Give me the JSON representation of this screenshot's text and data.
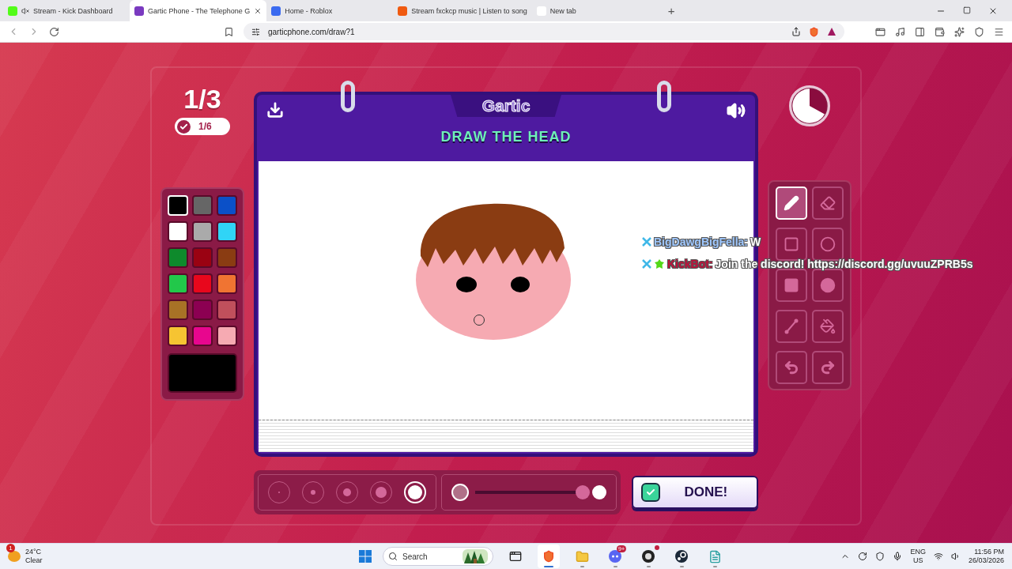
{
  "browser": {
    "tabs": [
      {
        "kind": "kick",
        "title": "Stream - Kick Dashboard",
        "muted": true,
        "selected": false
      },
      {
        "kind": "gartic",
        "title": "Gartic Phone - The Telephone G",
        "muted": false,
        "selected": true
      },
      {
        "kind": "roblox",
        "title": "Home - Roblox",
        "muted": false,
        "selected": false
      },
      {
        "kind": "soundcloud",
        "title": "Stream fxckcp music | Listen to song",
        "muted": false,
        "selected": false
      },
      {
        "kind": "brave",
        "title": "New tab",
        "muted": false,
        "selected": false
      }
    ],
    "new_tab": "+",
    "url": "garticphone.com/draw?1"
  },
  "game": {
    "round": "1/3",
    "done_count": "1/6",
    "logo": "Gartic",
    "prompt": "DRAW THE HEAD",
    "palette": [
      {
        "color": "#000000",
        "selected": true
      },
      {
        "color": "#666666",
        "selected": false
      },
      {
        "color": "#0b50c8",
        "selected": false
      },
      {
        "color": "#ffffff",
        "selected": false
      },
      {
        "color": "#aaaaaa",
        "selected": false
      },
      {
        "color": "#30d4f6",
        "selected": false
      },
      {
        "color": "#0e8a2c",
        "selected": false
      },
      {
        "color": "#9a0212",
        "selected": false
      },
      {
        "color": "#8a3c12",
        "selected": false
      },
      {
        "color": "#22c84a",
        "selected": false
      },
      {
        "color": "#e8071c",
        "selected": false
      },
      {
        "color": "#f07432",
        "selected": false
      },
      {
        "color": "#a87226",
        "selected": false
      },
      {
        "color": "#8c0052",
        "selected": false
      },
      {
        "color": "#c0505c",
        "selected": false
      },
      {
        "color": "#f6c432",
        "selected": false
      },
      {
        "color": "#e8068e",
        "selected": false
      },
      {
        "color": "#f6aab2",
        "selected": false
      }
    ],
    "tools": [
      {
        "kind": "pencil",
        "selected": true
      },
      {
        "kind": "eraser",
        "selected": false
      },
      {
        "kind": "rect",
        "selected": false
      },
      {
        "kind": "ellipse",
        "selected": false
      },
      {
        "kind": "rect-fill",
        "selected": false
      },
      {
        "kind": "ellipse-fill",
        "selected": false
      },
      {
        "kind": "line",
        "selected": false
      },
      {
        "kind": "bucket",
        "selected": false
      },
      {
        "kind": "undo",
        "selected": false
      },
      {
        "kind": "redo",
        "selected": false
      }
    ],
    "brush_sizes": [
      {
        "selected": false
      },
      {
        "selected": false
      },
      {
        "selected": false
      },
      {
        "selected": false
      },
      {
        "selected": true
      }
    ],
    "opacity": {
      "level": 0.97
    },
    "done_button": "DONE!"
  },
  "chat_overlay": [
    {
      "user": "BigDawgBigFella:",
      "message": "W",
      "color": "#9fc8ff",
      "bot": false
    },
    {
      "user": "KickBot:",
      "message": "Join the discord! https://discord.gg/uvuuZPRB5s",
      "color": "#c0103a",
      "bot": true
    }
  ],
  "taskbar": {
    "weather": {
      "alert": "1",
      "temperature": "24°C",
      "condition": "Clear"
    },
    "search": "Search",
    "apps": [
      {
        "kind": "taskview",
        "active": false,
        "notification_dot": false
      },
      {
        "kind": "brave",
        "active": true,
        "notification_dot": false
      },
      {
        "kind": "folder",
        "active": false,
        "notification_dot": false
      },
      {
        "kind": "discord",
        "active": false,
        "notification_dot": false,
        "badge": "9+"
      },
      {
        "kind": "obs",
        "active": false,
        "notification_dot": true
      },
      {
        "kind": "steam",
        "active": false,
        "notification_dot": false
      },
      {
        "kind": "notepad",
        "active": false,
        "notification_dot": false
      }
    ],
    "language": "ENG",
    "region": "US",
    "time": "11:56 PM",
    "date": "26/03/2026"
  }
}
